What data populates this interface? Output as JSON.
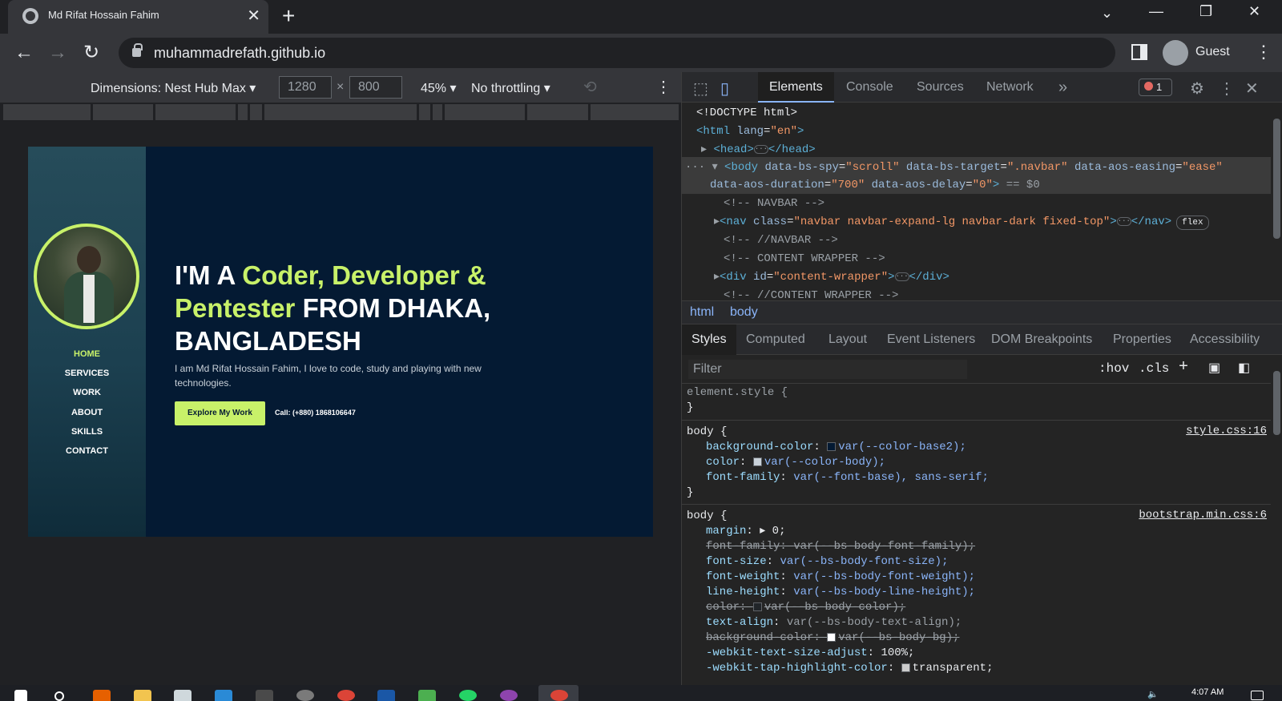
{
  "browser": {
    "tab_title": "Md Rifat Hossain Fahim",
    "tab_close": "✕",
    "new_tab": "+",
    "url": "muhammadrefath.github.io",
    "profile_label": "Guest",
    "window_controls": {
      "tabsearch": "⌄",
      "minimize": "—",
      "restore": "❐",
      "close": "✕"
    },
    "nav": {
      "back": "←",
      "forward": "→",
      "reload": "↻",
      "menu": "⋮"
    }
  },
  "device_toolbar": {
    "dimensions": "Dimensions: Nest Hub Max ▾",
    "width": "1280",
    "height": "800",
    "times": "×",
    "zoom": "45% ▾",
    "throttling": "No throttling ▾",
    "rotate": "⟲",
    "more": "⋮"
  },
  "site": {
    "nav": [
      "HOME",
      "SERVICES",
      "WORK",
      "ABOUT",
      "SKILLS",
      "CONTACT"
    ],
    "headline_pre": "I'M A ",
    "headline_accent": "Coder, Developer & Pentester",
    "headline_post": " FROM DHAKA, BANGLADESH",
    "intro": "I am Md Rifat Hossain Fahim, I love to code, study and playing with new technologies.",
    "cta": "Explore My Work",
    "phone": "Call: (+880) 1868106647",
    "colors": {
      "accent": "#c8f169",
      "background": "#041a33"
    }
  },
  "devtools": {
    "tabs": [
      "Elements",
      "Console",
      "Sources",
      "Network"
    ],
    "more_tabs": "»",
    "error_count": "1",
    "dom": {
      "doctype": "<!DOCTYPE html>",
      "html_open": "<html",
      "html_attr": "lang",
      "html_val": "\"en\"",
      "head_open": "<head>",
      "head_close": "</head>",
      "body_open": "<body",
      "body_attr1": "data-bs-spy",
      "body_val1": "\"scroll\"",
      "body_attr2": "data-bs-target",
      "body_val2": "\".navbar\"",
      "body_attr3": "data-aos-easing",
      "body_val3": "\"ease\"",
      "body_attr4": "data-aos-duration",
      "body_val4": "\"700\"",
      "body_attr5": "data-aos-delay",
      "body_val5": "\"0\"",
      "body_eq": " == $0",
      "c_navbar": "<!-- NAVBAR -->",
      "nav_open": "<nav",
      "nav_attr": "class",
      "nav_val": "\"navbar navbar-expand-lg navbar-dark fixed-top\"",
      "nav_close": "</nav>",
      "flex_badge": "flex",
      "c_navbar_end": "<!-- //NAVBAR -->",
      "c_content": "<!-- CONTENT WRAPPER -->",
      "div_open": "<div",
      "div_attr": "id",
      "div_val": "\"content-wrapper\"",
      "div_close": "</div>",
      "c_content_end": "<!-- //CONTENT WRAPPER -->"
    },
    "breadcrumbs": [
      "html",
      "body"
    ],
    "style_tabs": [
      "Styles",
      "Computed",
      "Layout",
      "Event Listeners",
      "DOM Breakpoints",
      "Properties",
      "Accessibility"
    ],
    "filter_placeholder": "Filter",
    "hov": ":hov",
    "cls": ".cls",
    "styles": {
      "element_style": "element.style {",
      "close_brace": "}",
      "rule1_selector": "body {",
      "rule1_source": "style.css:16",
      "rule1": [
        {
          "prop": "background-color",
          "val": "var(--color-base2);"
        },
        {
          "prop": "color",
          "val": "var(--color-body);"
        },
        {
          "prop": "font-family",
          "val": "var(--font-base), sans-serif;"
        }
      ],
      "rule2_selector": "body {",
      "rule2_source": "bootstrap.min.css:6",
      "rule2": [
        {
          "prop": "margin",
          "val": "▸ 0;"
        },
        {
          "prop": "font-family",
          "val": "var(--bs-body-font-family);"
        },
        {
          "prop": "font-size",
          "val": "var(--bs-body-font-size);"
        },
        {
          "prop": "font-weight",
          "val": "var(--bs-body-font-weight);"
        },
        {
          "prop": "line-height",
          "val": "var(--bs-body-line-height);"
        },
        {
          "prop": "color",
          "val": "var(--bs-body-color);"
        },
        {
          "prop": "text-align",
          "val": "var(--bs-body-text-align);"
        },
        {
          "prop": "background-color",
          "val": "var(--bs-body-bg);"
        },
        {
          "prop": "-webkit-text-size-adjust",
          "val": "100%;"
        },
        {
          "prop": "-webkit-tap-highlight-color",
          "val": "transparent;"
        }
      ]
    }
  },
  "taskbar": {
    "clock": "4:07 AM"
  }
}
